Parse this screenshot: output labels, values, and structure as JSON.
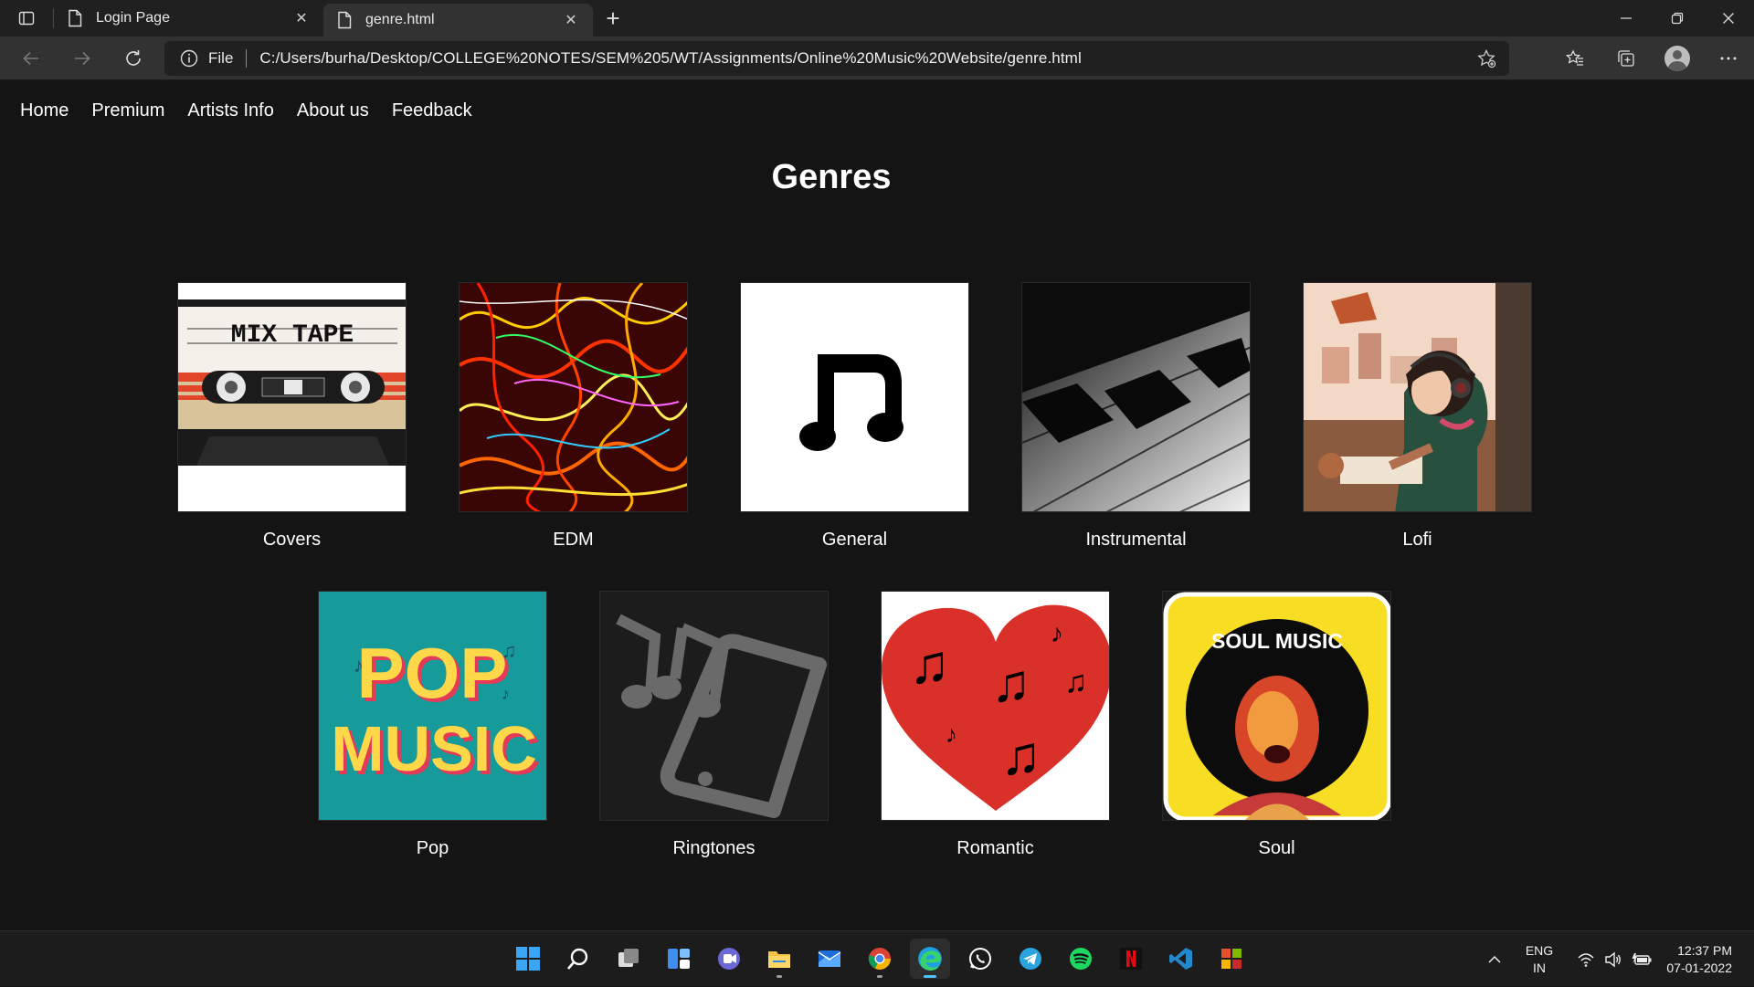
{
  "browser": {
    "tabs": [
      {
        "title": "Login Page",
        "active": false
      },
      {
        "title": "genre.html",
        "active": true
      }
    ],
    "address": {
      "scheme_label": "File",
      "url": "C:/Users/burha/Desktop/COLLEGE%20NOTES/SEM%205/WT/Assignments/Online%20Music%20Website/genre.html"
    }
  },
  "site": {
    "nav": [
      "Home",
      "Premium",
      "Artists Info",
      "About us",
      "Feedback"
    ],
    "title": "Genres",
    "genres": [
      {
        "name": "Covers",
        "artwork_text": [
          "MIX TAPE"
        ]
      },
      {
        "name": "EDM"
      },
      {
        "name": "General"
      },
      {
        "name": "Instrumental"
      },
      {
        "name": "Lofi"
      },
      {
        "name": "Pop",
        "artwork_text": [
          "POP",
          "MUSIC"
        ]
      },
      {
        "name": "Ringtones"
      },
      {
        "name": "Romantic"
      },
      {
        "name": "Soul",
        "artwork_text": [
          "SOUL MUSIC"
        ]
      }
    ]
  },
  "taskbar": {
    "apps": [
      "start-icon",
      "search-icon",
      "task-view-icon",
      "widgets-icon",
      "teams-chat-icon",
      "file-explorer-icon",
      "mail-icon",
      "chrome-icon",
      "edge-icon",
      "whatsapp-icon",
      "telegram-icon",
      "spotify-icon",
      "netflix-icon",
      "vscode-icon",
      "office-icon"
    ],
    "language": {
      "line1": "ENG",
      "line2": "IN"
    },
    "clock": {
      "time": "12:37 PM",
      "date": "07-01-2022"
    }
  },
  "colors": {
    "page_bg": "#141414",
    "tabstrip_bg": "#202020",
    "toolbar_bg": "#323232",
    "taskbar_bg": "#1c1c1c",
    "accent": "#4cc2ff"
  }
}
